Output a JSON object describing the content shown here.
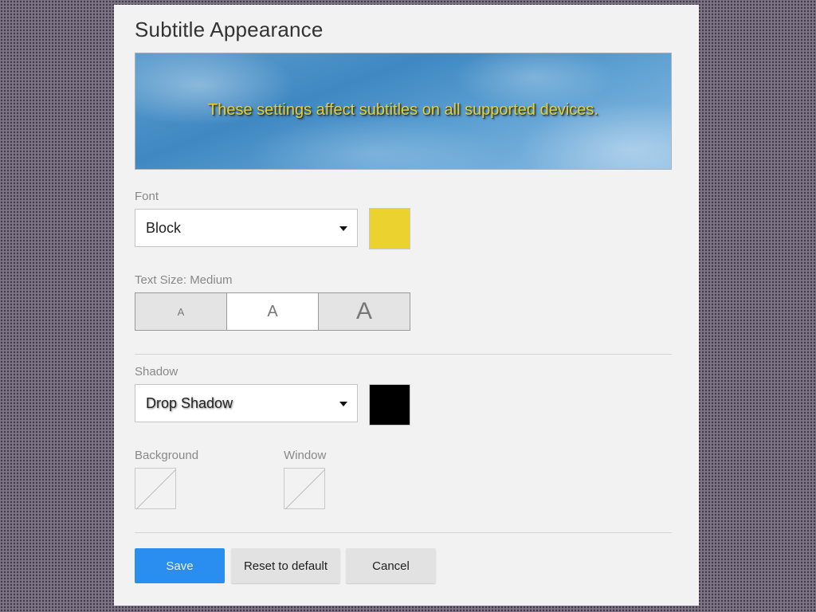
{
  "dialog": {
    "title": "Subtitle Appearance",
    "preview_text": "These settings affect subtitles on all supported devices."
  },
  "font": {
    "label": "Font",
    "selected": "Block",
    "color": "#ebd22e"
  },
  "text_size": {
    "label": "Text Size: Medium",
    "options": [
      {
        "glyph": "A",
        "name": "Small",
        "active": false
      },
      {
        "glyph": "A",
        "name": "Medium",
        "active": true
      },
      {
        "glyph": "A",
        "name": "Large",
        "active": false
      }
    ]
  },
  "shadow": {
    "label": "Shadow",
    "selected": "Drop Shadow",
    "color": "#000000"
  },
  "background": {
    "label": "Background",
    "value": "none"
  },
  "window": {
    "label": "Window",
    "value": "none"
  },
  "buttons": {
    "save": "Save",
    "reset": "Reset to default",
    "cancel": "Cancel"
  },
  "colors": {
    "primary": "#2a8ef0",
    "preview_text": "#e8d02a"
  }
}
